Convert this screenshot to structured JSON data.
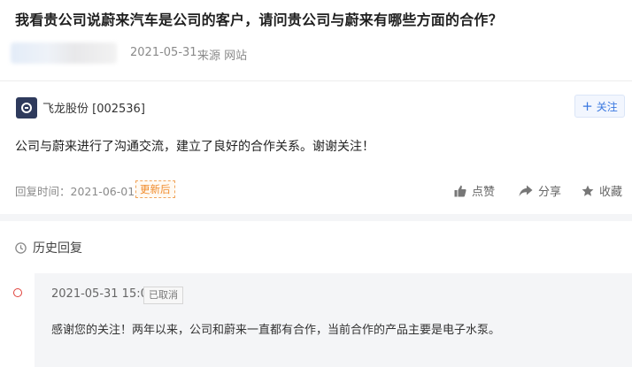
{
  "question": {
    "title": "我看贵公司说蔚来汽车是公司的客户，请问贵公司与蔚来有哪些方面的合作？",
    "date": "2021-05-31·",
    "source": "来源 网站"
  },
  "company": {
    "name_code": "飞龙股份 [002536]",
    "follow_label": "关注",
    "logo_icon": "company-logo-icon"
  },
  "answer": {
    "text": "公司与蔚来进行了沟通交流，建立了良好的合作关系。谢谢关注！",
    "reply_time": "回复时间：2021-06-01",
    "updated_badge": "更新后"
  },
  "actions": {
    "like": "点赞",
    "share": "分享",
    "collect": "收藏"
  },
  "history": {
    "title": "历史回复",
    "items": [
      {
        "date": "2021-05-31 15:04",
        "status": "已取消",
        "text": "感谢您的关注！两年以来，公司和蔚来一直都有合作，当前合作的产品主要是电子水泵。"
      }
    ]
  },
  "colors": {
    "accent_blue": "#3a78e0",
    "badge_orange": "#f08a2a",
    "timeline_red": "#e0403a"
  }
}
